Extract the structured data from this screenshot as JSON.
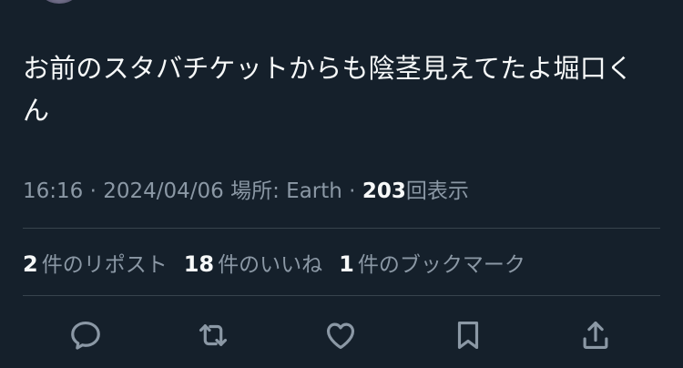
{
  "tweet": {
    "text": "お前のスタバチケットからも陰茎見えてたよ堀口くん",
    "time": "16:16",
    "date": "2024/04/06",
    "location_label": "場所: Earth",
    "views_count": "203",
    "views_label": "回表示",
    "separator": " · "
  },
  "stats": {
    "reposts": {
      "count": "2",
      "label": "件のリポスト"
    },
    "likes": {
      "count": "18",
      "label": "件のいいね"
    },
    "bookmarks": {
      "count": "1",
      "label": "件のブックマーク"
    }
  },
  "actions": [
    {
      "name": "reply",
      "icon": "reply-icon"
    },
    {
      "name": "repost",
      "icon": "repost-icon"
    },
    {
      "name": "like",
      "icon": "heart-icon"
    },
    {
      "name": "bookmark",
      "icon": "bookmark-icon"
    },
    {
      "name": "share",
      "icon": "share-icon"
    }
  ],
  "colors": {
    "background": "#15202b",
    "text_primary": "#f7f9f9",
    "text_secondary": "#8b98a5",
    "divider": "#38444d"
  }
}
